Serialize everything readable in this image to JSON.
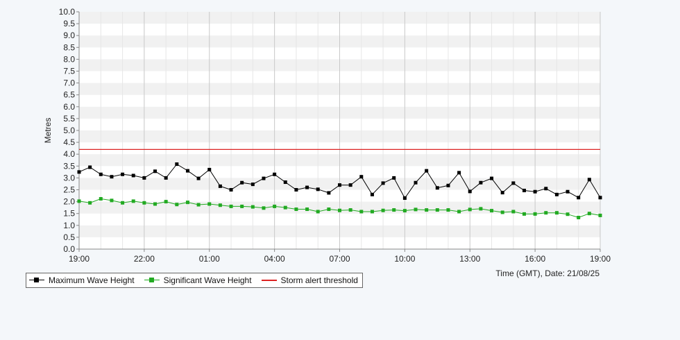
{
  "chart_data": {
    "type": "line",
    "ylabel": "Metres",
    "xlabel": "Time (GMT), Date: 21/08/25",
    "ylim": [
      0,
      10
    ],
    "y_ticks": [
      "0.0",
      "0.5",
      "1.0",
      "1.5",
      "2.0",
      "2.5",
      "3.0",
      "3.5",
      "4.0",
      "4.5",
      "5.0",
      "5.5",
      "6.0",
      "6.5",
      "7.0",
      "7.5",
      "8.0",
      "8.5",
      "9.0",
      "9.5",
      "10.0"
    ],
    "x_range_hours": [
      0,
      24
    ],
    "x_ticks": [
      {
        "label": "19:00",
        "hour": 0
      },
      {
        "label": "22:00",
        "hour": 3
      },
      {
        "label": "01:00",
        "hour": 6
      },
      {
        "label": "04:00",
        "hour": 9
      },
      {
        "label": "07:00",
        "hour": 12
      },
      {
        "label": "10:00",
        "hour": 15
      },
      {
        "label": "13:00",
        "hour": 18
      },
      {
        "label": "16:00",
        "hour": 21
      },
      {
        "label": "19:00",
        "hour": 24
      }
    ],
    "grid": true,
    "legend_position": "bottom-left",
    "series": [
      {
        "name": "Maximum Wave Height",
        "color": "#000000",
        "hours": [
          0,
          0.5,
          1,
          1.5,
          2,
          2.5,
          3,
          3.5,
          4,
          4.5,
          5,
          5.5,
          6,
          6.5,
          7,
          7.5,
          8,
          8.5,
          9,
          9.5,
          10,
          10.5,
          11,
          11.5,
          12,
          12.5,
          13,
          13.5,
          14,
          14.5,
          15,
          15.5,
          16,
          16.5,
          17,
          17.5,
          18,
          18.5,
          19,
          19.5,
          20,
          20.5,
          21,
          21.5,
          22,
          22.5,
          23,
          23.5,
          24
        ],
        "values": [
          3.25,
          3.45,
          3.15,
          3.05,
          3.15,
          3.1,
          3.0,
          3.28,
          3.0,
          3.58,
          3.3,
          2.98,
          3.35,
          2.65,
          2.5,
          2.8,
          2.73,
          2.98,
          3.15,
          2.82,
          2.5,
          2.6,
          2.52,
          2.37,
          2.7,
          2.7,
          3.05,
          2.3,
          2.78,
          3.0,
          2.15,
          2.8,
          3.3,
          2.58,
          2.68,
          3.22,
          2.43,
          2.8,
          2.98,
          2.38,
          2.78,
          2.47,
          2.42,
          2.55,
          2.3,
          2.42,
          2.17,
          2.93,
          2.17
        ]
      },
      {
        "name": "Significant Wave Height",
        "color": "#22aa22",
        "hours": [
          0,
          0.5,
          1,
          1.5,
          2,
          2.5,
          3,
          3.5,
          4,
          4.5,
          5,
          5.5,
          6,
          6.5,
          7,
          7.5,
          8,
          8.5,
          9,
          9.5,
          10,
          10.5,
          11,
          11.5,
          12,
          12.5,
          13,
          13.5,
          14,
          14.5,
          15,
          15.5,
          16,
          16.5,
          17,
          17.5,
          18,
          18.5,
          19,
          19.5,
          20,
          20.5,
          21,
          21.5,
          22,
          22.5,
          23,
          23.5,
          24
        ],
        "values": [
          2.02,
          1.95,
          2.12,
          2.05,
          1.95,
          2.02,
          1.95,
          1.9,
          2.0,
          1.88,
          1.97,
          1.87,
          1.9,
          1.85,
          1.8,
          1.8,
          1.78,
          1.73,
          1.8,
          1.75,
          1.68,
          1.68,
          1.58,
          1.68,
          1.63,
          1.65,
          1.58,
          1.58,
          1.63,
          1.65,
          1.62,
          1.67,
          1.65,
          1.65,
          1.65,
          1.58,
          1.67,
          1.7,
          1.62,
          1.55,
          1.58,
          1.48,
          1.48,
          1.53,
          1.53,
          1.47,
          1.33,
          1.5,
          1.42
        ]
      },
      {
        "name": "Storm alert threshold",
        "color": "#dd2222",
        "values": [
          4.2
        ]
      }
    ]
  }
}
